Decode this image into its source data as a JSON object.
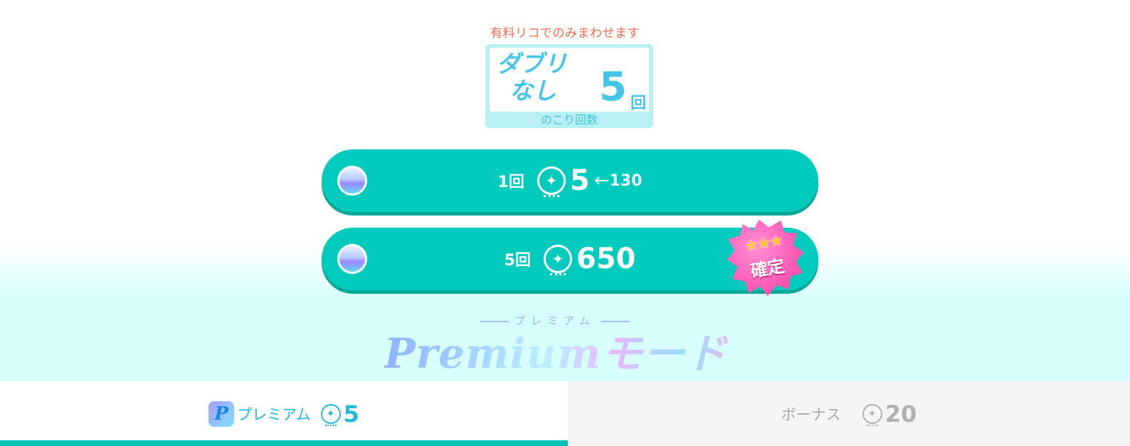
{
  "notice": "有料リコでのみまわせます",
  "no_duplicate": {
    "title_line1": "ダブリ",
    "title_line2": "なし",
    "count": "5",
    "unit": "回",
    "caption": "のこり回数"
  },
  "draw_buttons": [
    {
      "times": "1回",
      "price": "5",
      "arrow": "←",
      "original_price": "130"
    },
    {
      "times": "5回",
      "price": "650",
      "badge_label": "確定",
      "badge_stars": "★★★"
    }
  ],
  "mode": {
    "subtitle": "プレミアム",
    "title": "Premiumモード"
  },
  "tabs": [
    {
      "badge_letter": "P",
      "label": "プレミアム",
      "coin_glyph": "✦",
      "count": "5",
      "selected": true
    },
    {
      "label": "ボーナス",
      "coin_glyph": "✦",
      "count": "20",
      "selected": false
    }
  ],
  "colors": {
    "accent": "#00cbbc",
    "notice": "#f26a50",
    "no_duplicate": "#46c6e6",
    "badge_pink": "#ff5fb8"
  },
  "icons": {
    "orb": "crystal-orb-icon",
    "coin": "riko-coin-icon",
    "arrow": "arrow-left-icon",
    "badge": "guarantee-star-badge-icon",
    "premium": "premium-p-icon"
  }
}
